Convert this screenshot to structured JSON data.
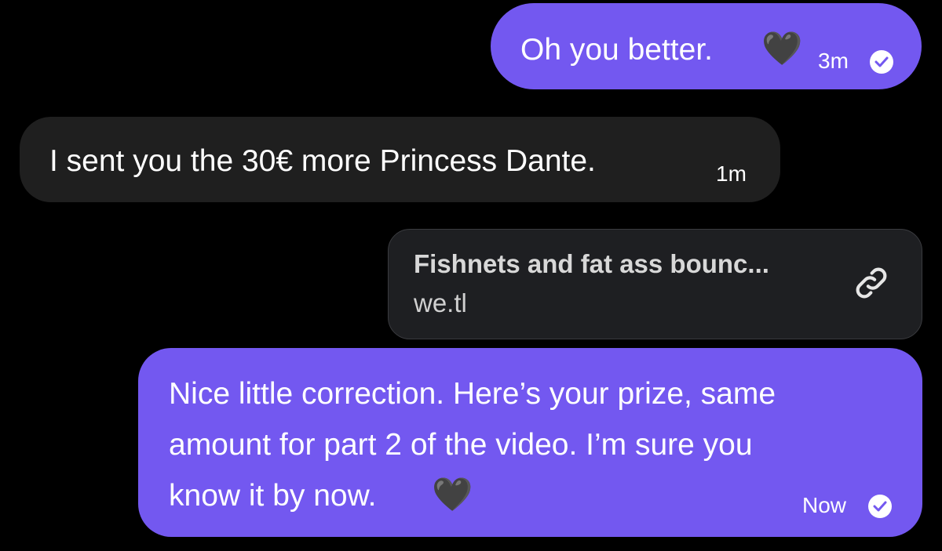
{
  "messages": [
    {
      "direction": "sent",
      "text": "Oh you better.",
      "emoji": "🖤",
      "time": "3m",
      "status_icon": "check-circle-icon"
    },
    {
      "direction": "received",
      "text": "I sent you the 30€ more Princess Dante.",
      "time": "1m"
    },
    {
      "direction": "sent",
      "link_preview": {
        "title": "Fishnets and fat ass bounc...",
        "domain": "we.tl",
        "icon": "link-icon"
      }
    },
    {
      "direction": "sent",
      "lines": [
        "Nice little correction. Here’s your prize, same",
        "amount for part 2 of the video. I’m sure you",
        "know it by now."
      ],
      "emoji": "🖤",
      "time": "Now",
      "status_icon": "check-circle-icon"
    }
  ],
  "colors": {
    "background": "#000000",
    "sent_bubble": "#7358f0",
    "received_bubble": "#1f1f1f",
    "link_card": "#1e1f22",
    "text": "#ffffff"
  }
}
